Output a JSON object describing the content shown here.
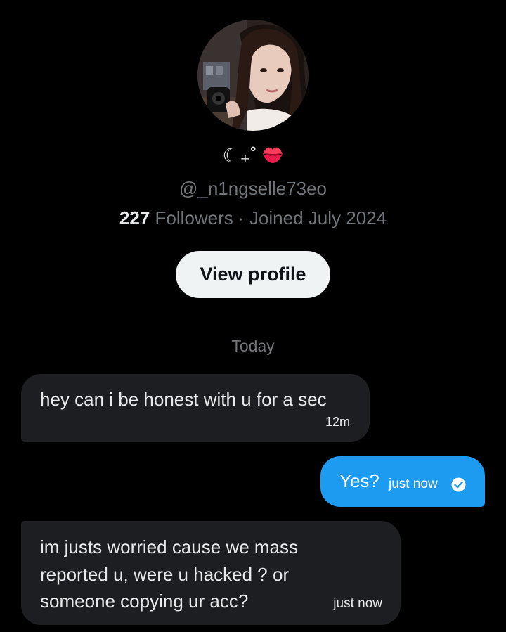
{
  "profile": {
    "display_name": "☾₊˚",
    "name_emoji_icon": "kiss-mark-icon",
    "handle": "@_n1ngselle73eo",
    "followers_count": "227",
    "followers_label": "Followers",
    "separator": "·",
    "joined": "Joined July 2024",
    "view_profile_label": "View profile"
  },
  "conversation": {
    "date_separator": "Today",
    "messages": [
      {
        "direction": "incoming",
        "text": "hey can i be honest with u for a sec",
        "time": "12m"
      },
      {
        "direction": "outgoing",
        "text": "Yes?",
        "time": "just now",
        "status_icon": "read-check-icon"
      },
      {
        "direction": "incoming",
        "text": "im justs worried cause we mass reported u, were u hacked ? or someone copying ur acc?",
        "time": "just now"
      }
    ]
  },
  "colors": {
    "background": "#000000",
    "incoming_bubble": "#1c1e21",
    "outgoing_bubble": "#1d9bf0",
    "secondary_text": "#71767b",
    "primary_text": "#e7e9ea",
    "button_bg": "#eff3f4"
  }
}
